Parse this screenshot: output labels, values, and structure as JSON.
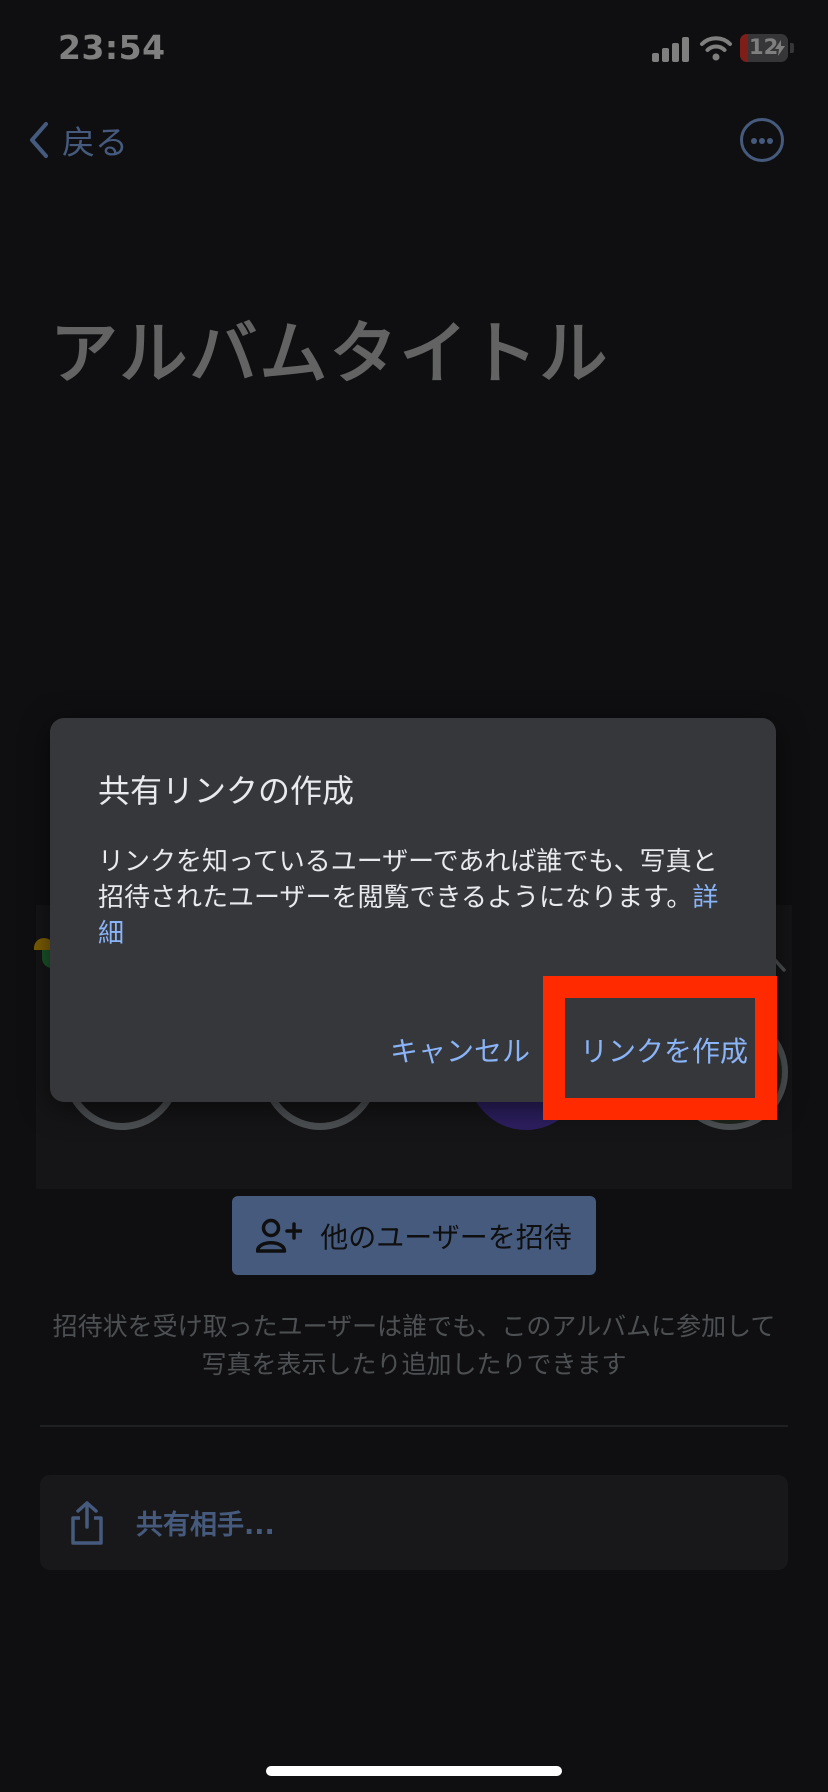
{
  "status_bar": {
    "time": "23:54",
    "battery_level": "12",
    "battery_charging": true
  },
  "nav": {
    "back_label": "戻る",
    "more_icon": "more-horizontal-icon"
  },
  "album": {
    "title": "アルバムタイトル"
  },
  "members": {
    "collapse_icon": "chevron-up-icon"
  },
  "invite": {
    "button_label": "他のユーザーを招待",
    "button_icon": "person-add-icon",
    "note": "招待状を受け取ったユーザーは誰でも、このアルバムに参加して写真を表示したり追加したりできます"
  },
  "share": {
    "label": "共有相手...",
    "icon": "share-icon"
  },
  "dialog": {
    "title": "共有リンクの作成",
    "body": "リンクを知っているユーザーであれば誰でも、写真と招待されたユーザーを閲覧できるようになります。",
    "details_link": "詳細",
    "cancel_label": "キャンセル",
    "create_label": "リンクを作成"
  },
  "colors": {
    "accent": "#8ab4f8",
    "highlight": "#ff2a00",
    "dialog_bg": "#36373b",
    "background": "#1e1f22"
  }
}
